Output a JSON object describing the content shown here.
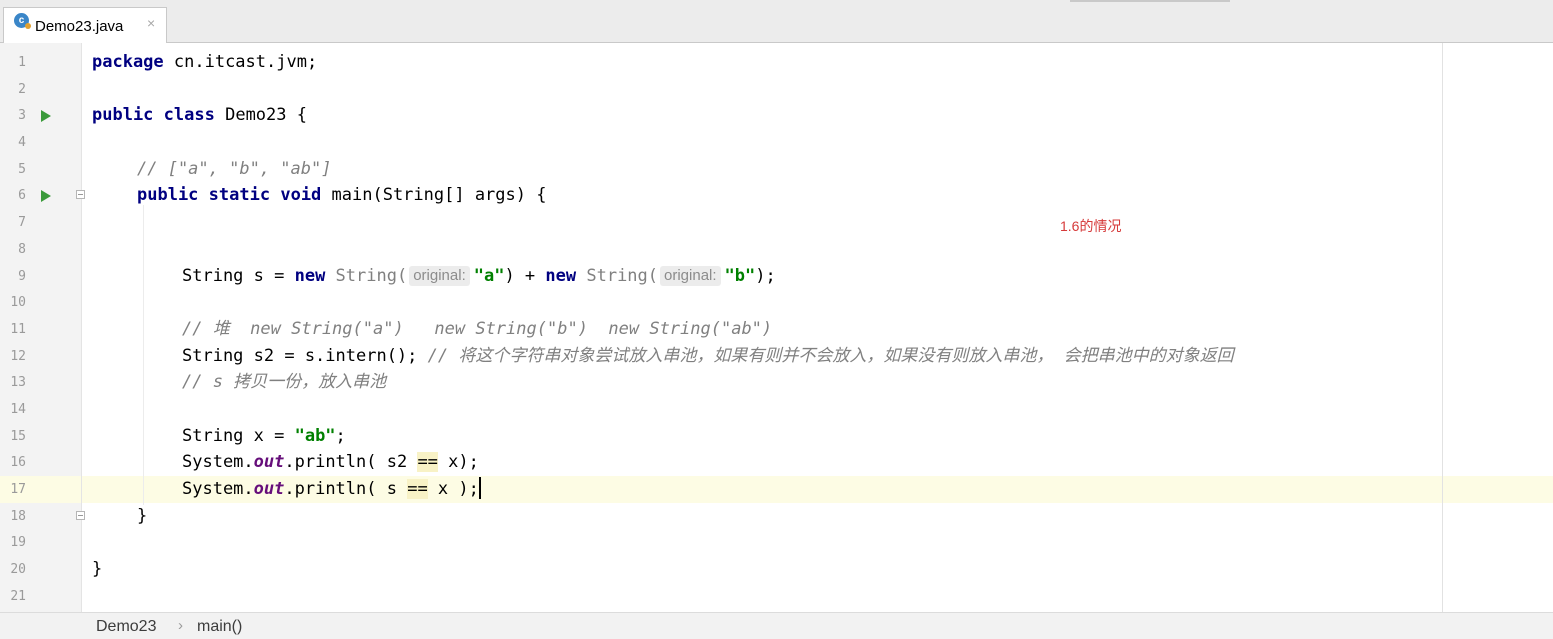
{
  "tab": {
    "title": "Demo23.java",
    "close": "×",
    "icon": "java-class-icon",
    "icon_letter": "c"
  },
  "editor": {
    "line_numbers": [
      "1",
      "2",
      "3",
      "4",
      "5",
      "6",
      "7",
      "8",
      "9",
      "10",
      "11",
      "12",
      "13",
      "14",
      "15",
      "16",
      "17",
      "18",
      "19",
      "20",
      "21"
    ],
    "current_line": 17,
    "annotation": "1.6的情况",
    "code": {
      "l1_kw": "package",
      "l1_rest": " cn.itcast.jvm;",
      "l3_kw1": "public",
      "l3_kw2": "class",
      "l3_rest": " Demo23 {",
      "l5_comment": "// [\"a\", \"b\", \"ab\"]",
      "l6_kw1": "public",
      "l6_kw2": "static",
      "l6_kw3": "void",
      "l6_rest": " main(String[] args) {",
      "l9_a": "String s = ",
      "l9_new1": "new",
      "l9_ctor1": " String(",
      "l9_hint1": "original:",
      "l9_str1": "\"a\"",
      "l9_mid": ") + ",
      "l9_new2": "new",
      "l9_ctor2": " String(",
      "l9_hint2": "original:",
      "l9_str2": "\"b\"",
      "l9_end": ");",
      "l11_comment": "// 堆  new String(\"a\")   new String(\"b\")  new String(\"ab\")",
      "l12_code": "String s2 = s.intern(); ",
      "l12_comment": "// 将这个字符串对象尝试放入串池，如果有则并不会放入，如果没有则放入串池， 会把串池中的对象返回",
      "l13_comment": "// s 拷贝一份，放入串池",
      "l15_code": "String x = ",
      "l15_str": "\"ab\"",
      "l15_end": ";",
      "l16_a": "System.",
      "l16_field": "out",
      "l16_b": ".println( s2 ",
      "l16_op": "==",
      "l16_c": " x);",
      "l17_a": "System.",
      "l17_field": "out",
      "l17_b": ".println( s ",
      "l17_op": "==",
      "l17_c": " x );",
      "l18_brace": "}",
      "l20_brace": "}"
    }
  },
  "breadcrumb": {
    "items": [
      "Demo23",
      "main()"
    ],
    "separator": "›"
  },
  "colors": {
    "keyword": "#000080",
    "comment": "#808080",
    "string": "#008000",
    "static_field": "#660e7a",
    "annotation": "#d63a3a",
    "current_line": "#fdfce4"
  }
}
